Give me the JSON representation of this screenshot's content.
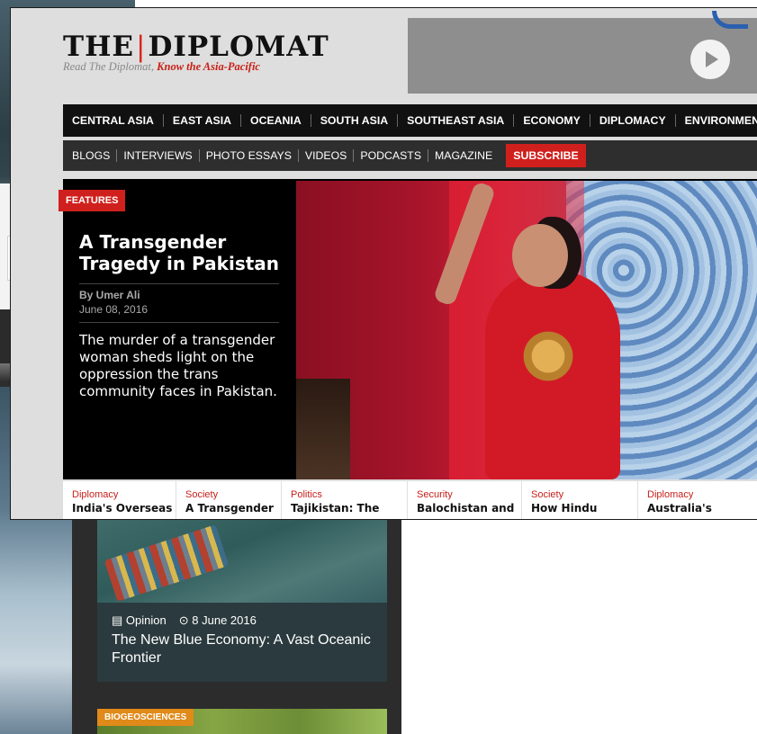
{
  "page": {
    "logo": {
      "title_left": "THE",
      "title_right": "DIPLOMAT",
      "tagline_prefix": "Read The Diplomat,",
      "tagline_emphasis": "Know the Asia-Pacific"
    },
    "nav_primary": [
      "CENTRAL ASIA",
      "EAST ASIA",
      "OCEANIA",
      "SOUTH ASIA",
      "SOUTHEAST ASIA",
      "ECONOMY",
      "DIPLOMACY",
      "ENVIRONMENT"
    ],
    "nav_secondary": [
      "BLOGS",
      "INTERVIEWS",
      "PHOTO ESSAYS",
      "VIDEOS",
      "PODCASTS",
      "MAGAZINE"
    ],
    "subscribe_label": "SUBSCRIBE",
    "feature": {
      "tag": "FEATURES",
      "title": "A Transgender Tragedy in Pakistan",
      "author": "By Umer Ali",
      "date": "June 08, 2016",
      "description": "The murder of a transgender woman sheds light on the oppression the trans community faces in Pakistan."
    },
    "story_strip": [
      {
        "category": "Diplomacy",
        "title": "India's Overseas"
      },
      {
        "category": "Society",
        "title": "A Transgender"
      },
      {
        "category": "Politics",
        "title": "Tajikistan: The"
      },
      {
        "category": "Security",
        "title": "Balochistan and"
      },
      {
        "category": "Society",
        "title": "How Hindu"
      },
      {
        "category": "Diplomacy",
        "title": "Australia's"
      }
    ]
  },
  "background_page": {
    "card_category": "Opinion",
    "card_date": "8 June 2016",
    "card_title": "The New Blue Economy: A Vast Oceanic Frontier",
    "second_card_tag": "BIOGEOSCIENCES"
  },
  "colors": {
    "accent_red": "#d0201d",
    "nav_black": "#111111",
    "nav_grey": "#2e2e2e",
    "category_red": "#c7201a"
  },
  "icons": {
    "play": "play-icon",
    "card_category": "newspaper-icon",
    "card_date": "clock-icon"
  }
}
